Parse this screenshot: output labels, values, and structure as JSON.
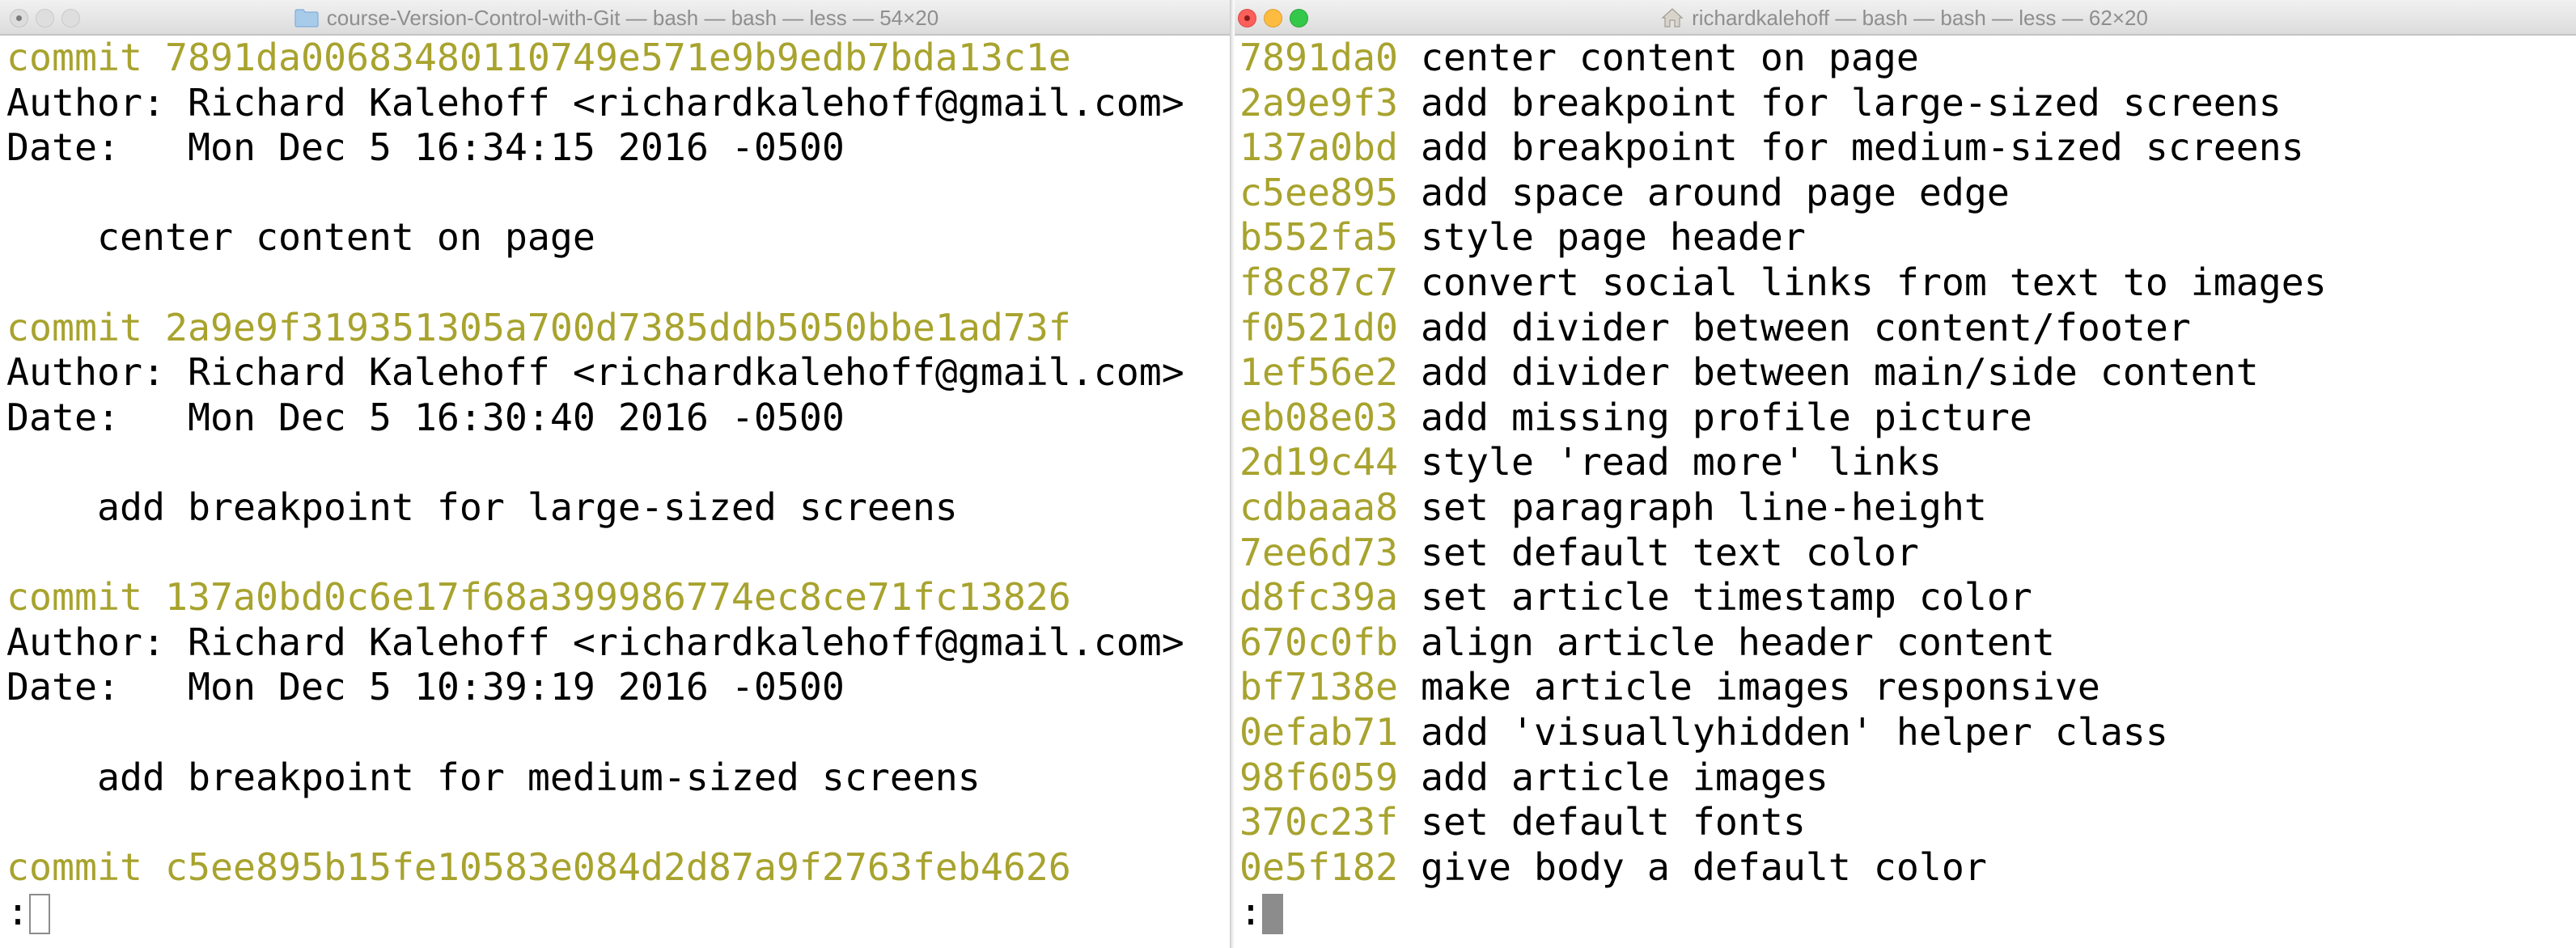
{
  "colors": {
    "hash": "#a8a32e",
    "text": "#000000",
    "title_text": "#8e8e8e",
    "close": "#fc605b",
    "minimize": "#fdbc40",
    "zoom": "#34c84a"
  },
  "left": {
    "title": "course-Version-Control-with-Git — bash — bash — less — 54×20",
    "title_icon": "folder-icon",
    "commits": [
      {
        "commit_label": "commit",
        "hash": "7891da00683480110749e571e9b9edb7bda13c1e",
        "author": "Author: Richard Kalehoff <richardkalehoff@gmail.com>",
        "date": "Date:   Mon Dec 5 16:34:15 2016 -0500",
        "message": "    center content on page"
      },
      {
        "commit_label": "commit",
        "hash": "2a9e9f319351305a700d7385ddb5050bbe1ad73f",
        "author": "Author: Richard Kalehoff <richardkalehoff@gmail.com>",
        "date": "Date:   Mon Dec 5 16:30:40 2016 -0500",
        "message": "    add breakpoint for large-sized screens"
      },
      {
        "commit_label": "commit",
        "hash": "137a0bd0c6e17f68a399986774ec8ce71fc13826",
        "author": "Author: Richard Kalehoff <richardkalehoff@gmail.com>",
        "date": "Date:   Mon Dec 5 10:39:19 2016 -0500",
        "message": "    add breakpoint for medium-sized screens"
      }
    ],
    "last_commit_label": "commit",
    "last_hash": "c5ee895b15fe10583e084d2d87a9f2763feb4626",
    "prompt": ":"
  },
  "right": {
    "title": "richardkalehoff — bash — bash — less — 62×20",
    "title_icon": "home-icon",
    "rows": [
      {
        "hash": "7891da0",
        "message": "center content on page"
      },
      {
        "hash": "2a9e9f3",
        "message": "add breakpoint for large-sized screens"
      },
      {
        "hash": "137a0bd",
        "message": "add breakpoint for medium-sized screens"
      },
      {
        "hash": "c5ee895",
        "message": "add space around page edge"
      },
      {
        "hash": "b552fa5",
        "message": "style page header"
      },
      {
        "hash": "f8c87c7",
        "message": "convert social links from text to images"
      },
      {
        "hash": "f0521d0",
        "message": "add divider between content/footer"
      },
      {
        "hash": "1ef56e2",
        "message": "add divider between main/side content"
      },
      {
        "hash": "eb08e03",
        "message": "add missing profile picture"
      },
      {
        "hash": "2d19c44",
        "message": "style 'read more' links"
      },
      {
        "hash": "cdbaaa8",
        "message": "set paragraph line-height"
      },
      {
        "hash": "7ee6d73",
        "message": "set default text color"
      },
      {
        "hash": "d8fc39a",
        "message": "set article timestamp color"
      },
      {
        "hash": "670c0fb",
        "message": "align article header content"
      },
      {
        "hash": "bf7138e",
        "message": "make article images responsive"
      },
      {
        "hash": "0efab71",
        "message": "add 'visuallyhidden' helper class"
      },
      {
        "hash": "98f6059",
        "message": "add article images"
      },
      {
        "hash": "370c23f",
        "message": "set default fonts"
      },
      {
        "hash": "0e5f182",
        "message": "give body a default color"
      }
    ],
    "prompt": ":"
  }
}
